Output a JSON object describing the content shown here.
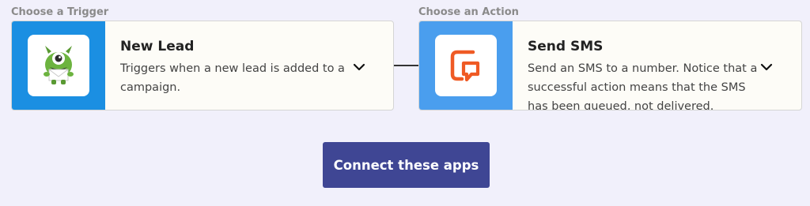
{
  "trigger": {
    "section_label": "Choose a Trigger",
    "app_icon": "optinmonster-icon",
    "title": "New Lead",
    "description": "Triggers when a new lead is added to a campaign."
  },
  "action": {
    "section_label": "Choose an Action",
    "app_icon": "sms-icon",
    "title": "Send SMS",
    "description": "Send an SMS to a number. Notice that a successful action means that the SMS has been queued, not delivered."
  },
  "connect_button": {
    "label": "Connect these apps"
  },
  "colors": {
    "background": "#f1f0fb",
    "trigger_icon_panel": "#1b8fe2",
    "action_icon_panel": "#4a9eee",
    "button": "#3f4694",
    "sms_icon_orange": "#ef5a24",
    "monster_green": "#6cb33f"
  }
}
